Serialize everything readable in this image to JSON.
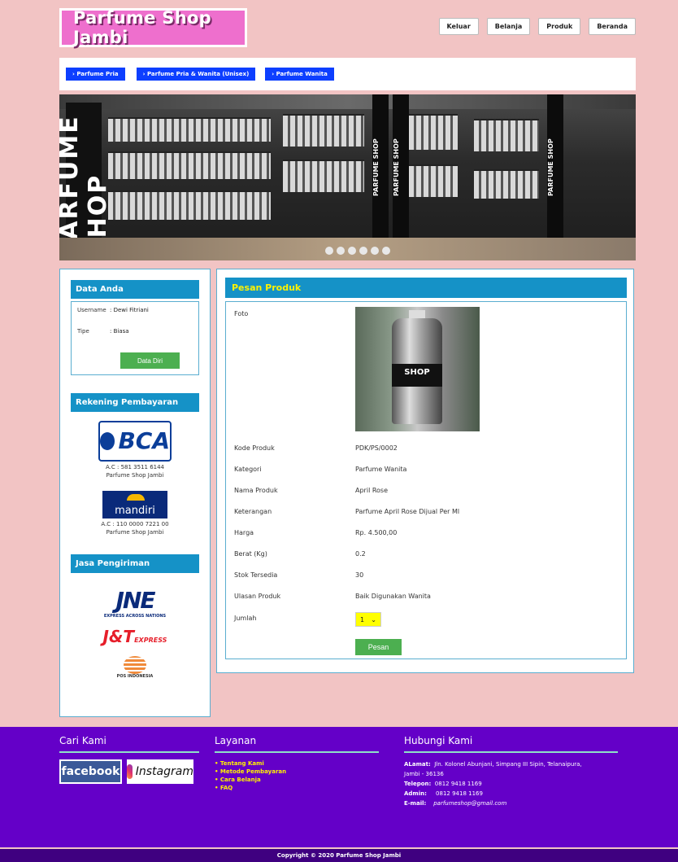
{
  "site": {
    "logo_text": "Parfume Shop Jambi"
  },
  "topnav": [
    "Keluar",
    "Belanja",
    "Produk",
    "Beranda"
  ],
  "categories": [
    "› Parfume Pria",
    "› Parfume Pria & Wanita (Unisex)",
    "› Parfume Wanita"
  ],
  "banner": {
    "slide_count": 6,
    "active_slide": 0,
    "big_text": "PARFUME SHOP",
    "pillar_text": "PARFUME SHOP"
  },
  "sidebar": {
    "data_title": "Data Anda",
    "username_label": "Username",
    "username_value": ": Dewi Fitriani",
    "tipe_label": "Tipe",
    "tipe_value": ": Biasa",
    "data_button": "Data Diri",
    "rekening_title": "Rekening Pembayaran",
    "bca": {
      "logo": "BCA",
      "account": "A.C : 581 3511 6144",
      "name": "Parfume Shop Jambi"
    },
    "mandiri": {
      "logo": "mandiri",
      "account": "A.C : 110 0000 7221 00",
      "name": "Parfume Shop Jambi"
    },
    "shipping_title": "Jasa Pengiriman",
    "jne": {
      "logo": "JNE",
      "sub": "EXPRESS ACROSS NATIONS"
    },
    "jnt": {
      "logo": "J&T",
      "sub": "EXPRESS"
    },
    "pos": {
      "label": "POS INDONESIA"
    }
  },
  "product": {
    "title": "Pesan Produk",
    "photo_label": "Foto",
    "photo_text": "SHOP",
    "fields": [
      {
        "label": "Kode Produk",
        "value": "PDK/PS/0002"
      },
      {
        "label": "Kategori",
        "value": "Parfume Wanita"
      },
      {
        "label": "Nama Produk",
        "value": "April Rose"
      },
      {
        "label": "Keterangan",
        "value": "Parfume April Rose Dijual Per Ml"
      },
      {
        "label": "Harga",
        "value": "Rp. 4.500,00"
      },
      {
        "label": "Berat (Kg)",
        "value": "0.2"
      },
      {
        "label": "Stok Tersedia",
        "value": "30"
      },
      {
        "label": "Ulasan Produk",
        "value": "Baik Digunakan Wanita"
      }
    ],
    "qty_label": "Jumlah",
    "qty_value": "1",
    "submit_label": "Pesan"
  },
  "footer": {
    "cari_title": "Cari Kami",
    "facebook": "facebook",
    "instagram": "Instagram",
    "layanan_title": "Layanan",
    "layanan": [
      "• Tentang Kami",
      "• Metode Pembayaran",
      "• Cara Belanja",
      "• FAQ"
    ],
    "hubungi_title": "Hubungi Kami",
    "alamat_label": "ALamat:",
    "alamat_value": "Jln. Kolonel Abunjani, Simpang III Sipin, Telanaipura,",
    "alamat_value2": "Jambi - 36136",
    "telepon_label": "Telepon:",
    "telepon_value": "0812 9418 1169",
    "admin_label": "Admin:",
    "admin_value": "0812 9418 1169",
    "email_label": "E-mail:",
    "email_value": "parfumeshop@gmail.com",
    "copyright": "Copyright © 2020 Parfume Shop Jambi"
  },
  "colors": {
    "page_bg": "#f2c4c4",
    "accent_blue": "#1592c7",
    "footer_purple": "#6400c8",
    "button_green": "#4caf50",
    "logo_pink": "#ee6fcd"
  }
}
